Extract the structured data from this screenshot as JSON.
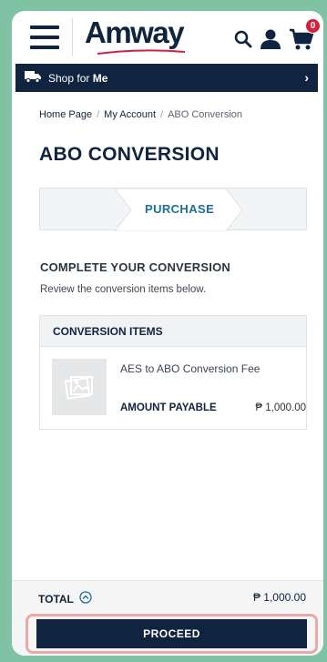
{
  "header": {
    "logo_text": "Amway",
    "cart_count": "0"
  },
  "shop_bar": {
    "label_prefix": "Shop for ",
    "label_bold": "Me",
    "chevron": "›"
  },
  "breadcrumb": {
    "items": [
      "Home Page",
      "My Account",
      "ABO Conversion"
    ],
    "separator": "/"
  },
  "page": {
    "title": "ABO CONVERSION"
  },
  "stepper": {
    "current_step": "PURCHASE"
  },
  "section": {
    "title": "COMPLETE YOUR CONVERSION",
    "subtitle": "Review the conversion items below."
  },
  "items": {
    "header": "CONVERSION ITEMS",
    "rows": [
      {
        "name": "AES to ABO Conversion Fee",
        "amount_label": "AMOUNT PAYABLE",
        "amount": "₱ 1,000.00"
      }
    ]
  },
  "footer": {
    "total_label": "TOTAL",
    "total_value": "₱ 1,000.00",
    "proceed_label": "PROCEED"
  },
  "colors": {
    "navy": "#10233f",
    "accent_blue": "#1d6e9a",
    "badge_red": "#d4213d",
    "background_green": "#7fc3a4",
    "highlight_pink": "#e8a9a9"
  },
  "icons": {
    "menu": "hamburger-menu-icon",
    "search": "search-icon",
    "account": "user-icon",
    "cart": "cart-icon",
    "truck": "truck-icon",
    "chevron_up": "chevron-up-circle-icon",
    "image_placeholder": "image-placeholder-icon"
  }
}
